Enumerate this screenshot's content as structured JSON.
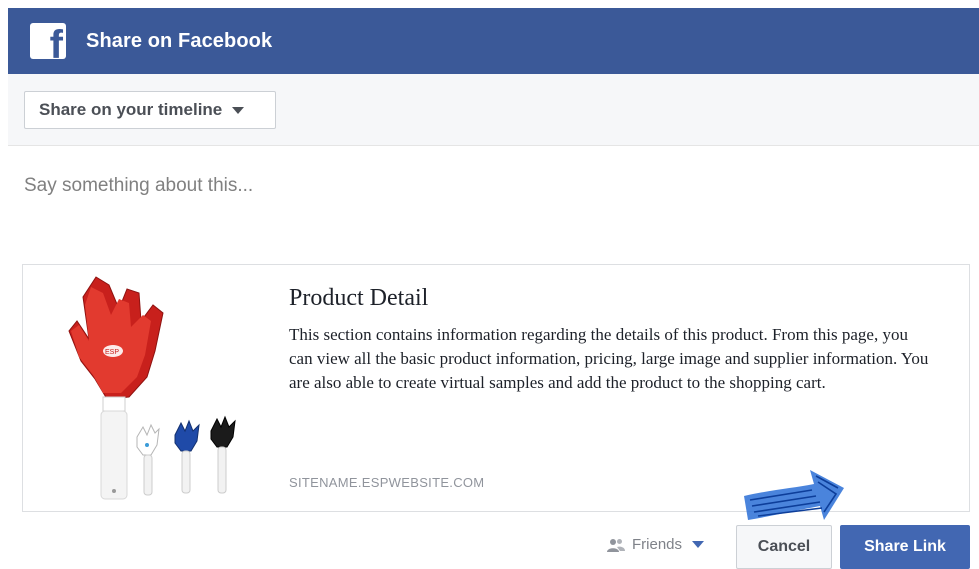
{
  "header": {
    "title": "Share on Facebook",
    "logo_letter": "f"
  },
  "audience": {
    "label": "Share on your timeline",
    "icon": "chevron-down-icon"
  },
  "composer": {
    "placeholder": "Say something about this..."
  },
  "preview": {
    "title": "Product Detail",
    "description": "This section contains information regarding the details of this product. From this page, you can view all the basic product information, pricing, large image and supplier information. You are also able to create virtual samples and add the product to the shopping cart.",
    "domain": "SITENAME.ESPWEBSITE.COM",
    "image": "hand-clapper-product-image",
    "image_brand_text": "ESP"
  },
  "footer": {
    "privacy_label": "Friends",
    "privacy_icon": "friends-icon",
    "cancel_label": "Cancel",
    "share_label": "Share Link"
  },
  "colors": {
    "brand": "#3b5998",
    "primary_button": "#4267b2",
    "annotation_arrow": "#1f5fc4"
  }
}
